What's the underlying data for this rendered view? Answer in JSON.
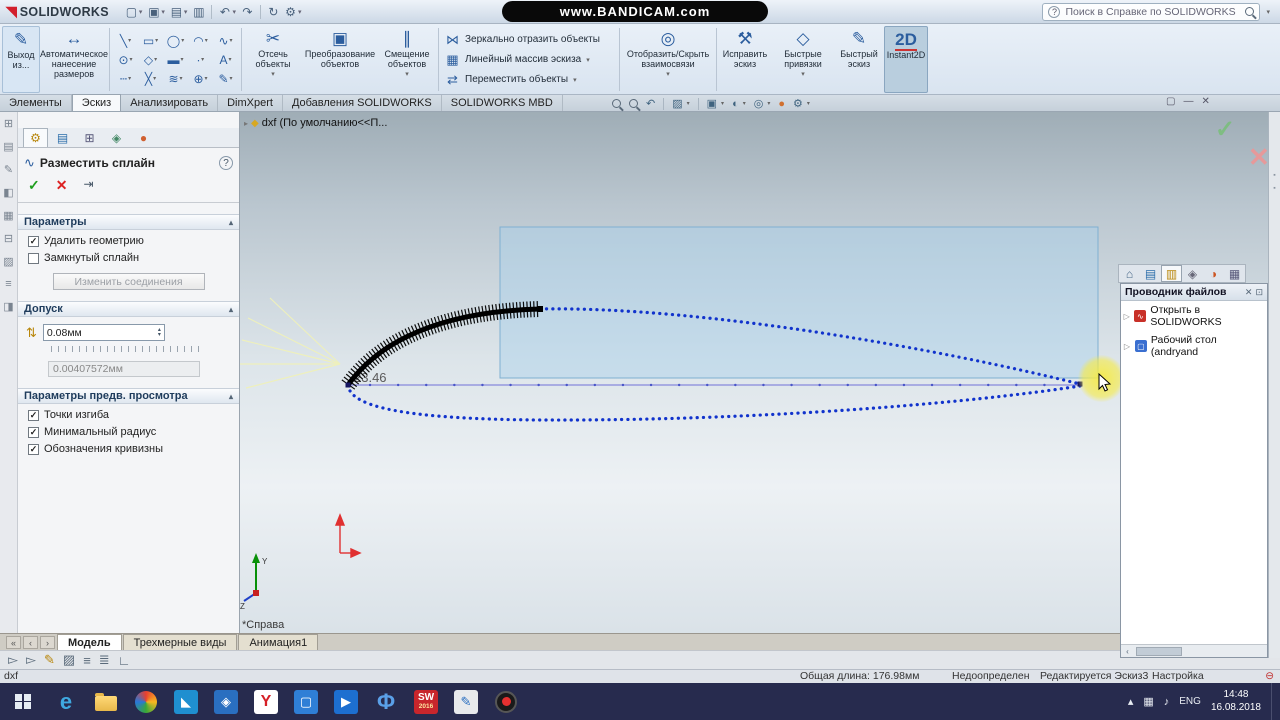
{
  "title_bar": {
    "app": "SOLIDWORKS",
    "watermark": "www.BANDICAM.com",
    "search_placeholder": "Поиск в Справке по SOLIDWORKS"
  },
  "ribbon": {
    "exit_sketch": "Выход из...",
    "smart_dimension": "Автоматическое нанесение размеров",
    "trim": "Отсечь объекты",
    "convert": "Преобразование объектов",
    "offset": "Смещение объектов",
    "mirror": "Зеркально отразить объекты",
    "linear_pattern": "Линейный массив эскиза",
    "move": "Переместить объекты",
    "relations": "Отобразить/Скрыть взаимосвязи",
    "repair": "Исправить эскиз",
    "snaps": "Быстрые привязки",
    "rapid": "Быстрый эскиз",
    "instant2d": "Instant2D",
    "instant2d_icon": "2D"
  },
  "command_tabs": [
    "Элементы",
    "Эскиз",
    "Анализировать",
    "DimXpert",
    "Добавления SOLIDWORKS",
    "SOLIDWORKS MBD"
  ],
  "feature_tree": {
    "root": "dxf (По умолчанию<<П..."
  },
  "property_manager": {
    "title": "Разместить сплайн",
    "sections": {
      "parameters": "Параметры",
      "tolerance": "Допуск",
      "preview": "Параметры предв. просмотра"
    },
    "checkboxes": {
      "delete_geometry": "Удалить геометрию",
      "closed_spline": "Замкнутый сплайн",
      "inflection_points": "Точки изгиба",
      "minimum_radius": "Минимальный радиус",
      "curvature_combs": "Обозначения кривизны"
    },
    "checkbox_states": {
      "delete_geometry": true,
      "closed_spline": false,
      "inflection_points": true,
      "minimum_radius": true,
      "curvature_combs": true
    },
    "edit_chaining_button": "Изменить соединения",
    "tolerance_value": "0.08мм",
    "tolerance_result": "0.00407572мм"
  },
  "viewport": {
    "dimension": "23.46",
    "view_label": "*Справа"
  },
  "task_pane": {
    "title": "Проводник файлов",
    "items": [
      "Открыть в SOLIDWORKS",
      "Рабочий стол (andryand"
    ]
  },
  "model_tabs": [
    "Модель",
    "Трехмерные виды",
    "Анимация1"
  ],
  "status_bar": {
    "left": "dxf",
    "length": "Общая длина: 176.98мм",
    "state": "Недоопределен",
    "editing": "Редактируется Эскиз3",
    "custom": "Настройка"
  },
  "taskbar": {
    "time": "14:48",
    "date": "16.08.2018",
    "lang": "ENG",
    "sw_line1": "SW",
    "sw_line2": "2016"
  },
  "colors": {
    "accent_blue": "#1538c8",
    "selection_fill": "#a8d0ec",
    "highlight_yellow": "#f6eb46",
    "solidworks_red": "#d21f2c"
  },
  "icons": {
    "check": "✓",
    "cross": "✕",
    "close": "✕",
    "minus_circle": "⊖",
    "chevron_down": "▾",
    "chevron_up": "▴",
    "chevron_right": "▸",
    "tri_right": "▷",
    "minimize": "—",
    "restore": "▢",
    "new": "▢",
    "open": "▣",
    "save": "▤",
    "print": "▥",
    "undo": "↶",
    "redo": "↷",
    "rebuild": "↻",
    "gear": "⚙",
    "help": "?",
    "pencil": "✎",
    "scissors": "✂",
    "mirror": "⋈",
    "pattern": "▦",
    "move": "⇄",
    "relations": "◎",
    "repair": "⚒",
    "snaps": "◇",
    "offset": "∥",
    "convert": "▣",
    "dimension": "↔",
    "tolerance": "⇅",
    "home": "⌂",
    "section": "▨",
    "orientation": "▣",
    "display_style": "◐",
    "hide_show": "◎",
    "appearance": "●",
    "spline": "∿",
    "pin": "⇥",
    "dock": "⊡",
    "sketch_tools": [
      "╲",
      "▭",
      "◯",
      "◠",
      "∿",
      "⊙",
      "◇",
      "▬",
      "∙",
      "A",
      "┄",
      "╳",
      "≋",
      "⊕",
      "✎"
    ],
    "pm_tabs": [
      "⚙",
      "▤",
      "⊞",
      "◈",
      "●"
    ],
    "tp_tabs": [
      "⌂",
      "▤",
      "▥",
      "◈",
      "◑",
      "▦"
    ],
    "left_tools": [
      "⊞",
      "▤",
      "✎",
      "◧",
      "▦",
      "⊟",
      "▨",
      "≡",
      "◨"
    ],
    "filter_tools": [
      "▻",
      "▻",
      "✎",
      "▨",
      "≡",
      "≣",
      "∟"
    ],
    "model_nav": [
      "«",
      "‹",
      "›"
    ]
  }
}
